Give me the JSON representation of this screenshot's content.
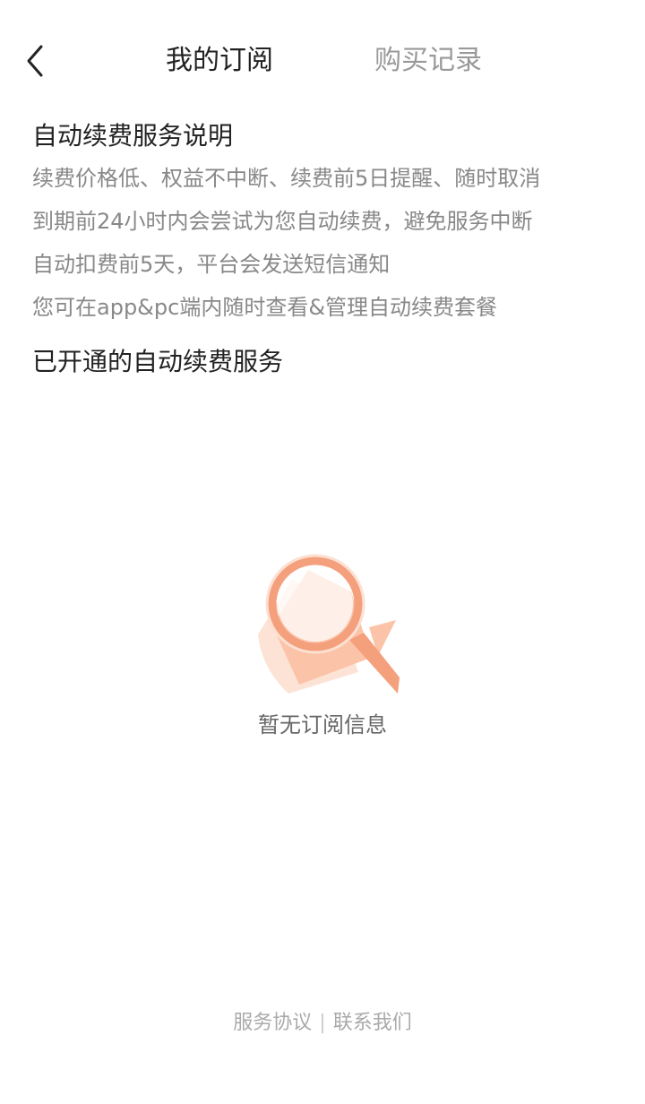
{
  "header": {
    "back_icon": "chevron-left-icon",
    "tabs": [
      {
        "label": "我的订阅",
        "active": true
      },
      {
        "label": "购买记录",
        "active": false
      }
    ]
  },
  "intro": {
    "title": "自动续费服务说明",
    "lines": [
      "续费价格低、权益不中断、续费前5日提醒、随时取消",
      "到期前24小时内会尝试为您自动续费，避免服务中断",
      "自动扣费前5天，平台会发送短信通知",
      "您可在app&pc端内随时查看&管理自动续费套餐"
    ]
  },
  "active_services": {
    "title": "已开通的自动续费服务",
    "empty_icon": "magnifier-empty-icon",
    "empty_text": "暂无订阅信息"
  },
  "footer": {
    "links": [
      "服务协议",
      "联系我们"
    ],
    "separator": "|"
  },
  "colors": {
    "accent_orange": "#F7A07A",
    "text_primary": "#222222",
    "text_secondary": "#888888"
  }
}
